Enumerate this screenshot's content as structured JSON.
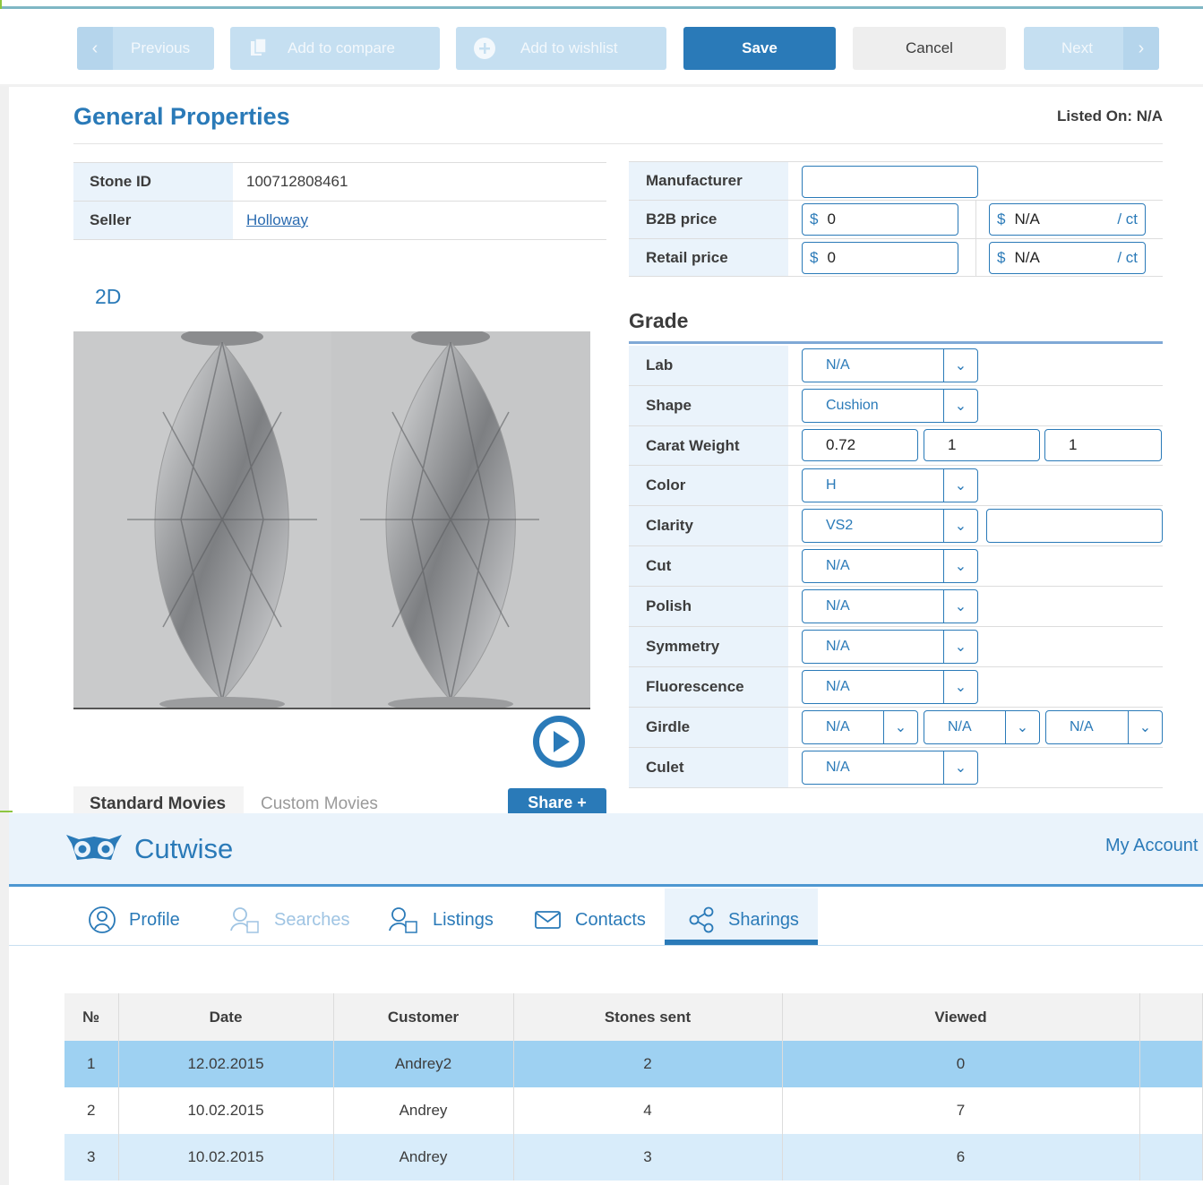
{
  "toolbar": {
    "previous": "Previous",
    "add_to_compare": "Add to compare",
    "add_to_wishlist": "Add to wishlist",
    "save": "Save",
    "cancel": "Cancel",
    "next": "Next"
  },
  "general": {
    "title": "General Properties",
    "listed_on": "Listed On: N/A",
    "stone_id_label": "Stone ID",
    "stone_id": "100712808461",
    "seller_label": "Seller",
    "seller": "Holloway"
  },
  "media": {
    "view_label": "2D",
    "tabs": [
      "Standard Movies",
      "Custom Movies"
    ],
    "share": "Share +"
  },
  "pricing": {
    "manufacturer_label": "Manufacturer",
    "manufacturer": "",
    "b2b_label": "B2B price",
    "b2b_price": "0",
    "b2b_per_ct": "N/A",
    "retail_label": "Retail price",
    "retail_price": "0",
    "retail_per_ct": "N/A",
    "currency": "$",
    "per_ct": "/ ct"
  },
  "grade": {
    "title": "Grade",
    "lab_label": "Lab",
    "lab": "N/A",
    "shape_label": "Shape",
    "shape": "Cushion",
    "carat_label": "Carat Weight",
    "carat": "0.72",
    "carat_min": "1",
    "carat_max": "1",
    "color_label": "Color",
    "color": "H",
    "clarity_label": "Clarity",
    "clarity": "VS2",
    "clarity_extra": "",
    "cut_label": "Cut",
    "cut": "N/A",
    "polish_label": "Polish",
    "polish": "N/A",
    "symmetry_label": "Symmetry",
    "symmetry": "N/A",
    "fluorescence_label": "Fluorescence",
    "fluorescence": "N/A",
    "girdle_label": "Girdle",
    "girdle_1": "N/A",
    "girdle_2": "N/A",
    "girdle_3": "N/A",
    "culet_label": "Culet",
    "culet": "N/A"
  },
  "app": {
    "brand": "Cutwise",
    "my_account": "My Account",
    "tabs": [
      "Profile",
      "Searches",
      "Listings",
      "Contacts",
      "Sharings"
    ]
  },
  "sharings": {
    "columns": [
      "№",
      "Date",
      "Customer",
      "Stones sent",
      "Viewed"
    ],
    "rows": [
      [
        "1",
        "12.02.2015",
        "Andrey2",
        "2",
        "0"
      ],
      [
        "2",
        "10.02.2015",
        "Andrey",
        "4",
        "7"
      ],
      [
        "3",
        "10.02.2015",
        "Andrey",
        "3",
        "6"
      ]
    ]
  },
  "colors": {
    "primary": "#2a7ab8",
    "light_blue": "#eaf3fb",
    "selected_row": "#9ed1f2"
  }
}
